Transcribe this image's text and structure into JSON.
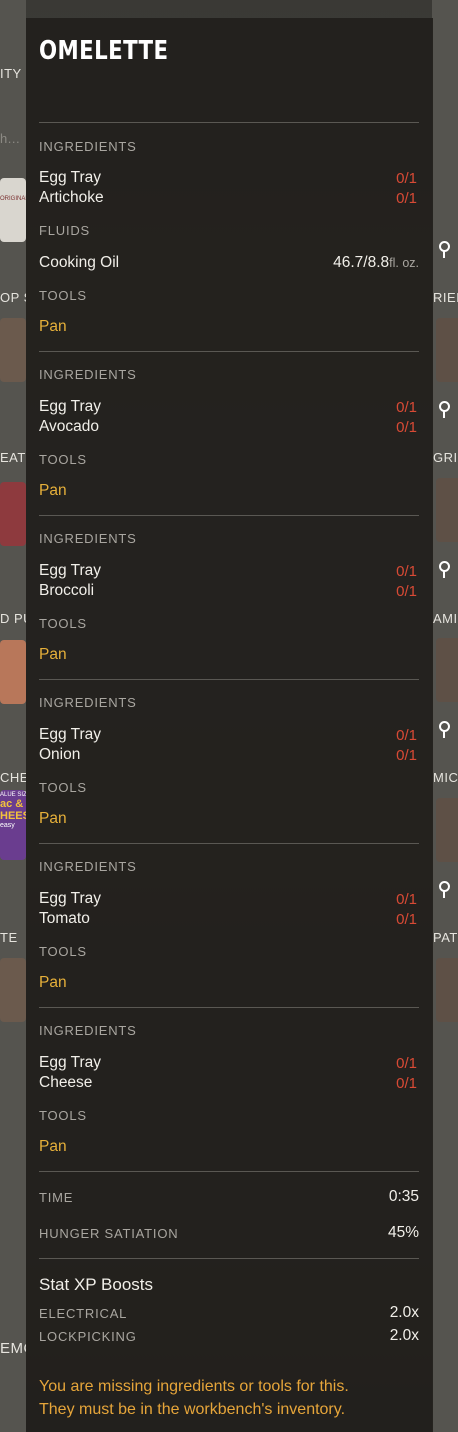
{
  "background": {
    "left_labels": [
      "ITY",
      "h...",
      "OP S",
      "EAT",
      "D PU",
      "CHE",
      "TE",
      "EMO"
    ],
    "right_labels": [
      "RIEI",
      "GRIL",
      "AMI",
      "MICH",
      "PATI"
    ],
    "thumb_text": [
      "ORIGINAL",
      "ac &",
      "HEESI",
      "ALUE SIZE",
      "easy"
    ]
  },
  "recipe": {
    "title": "OMELETTE",
    "headings": {
      "ingredients": "INGREDIENTS",
      "fluids": "FLUIDS",
      "tools": "TOOLS"
    },
    "variants": [
      {
        "ingredients": [
          {
            "name": "Egg Tray",
            "qty": "0/1"
          },
          {
            "name": "Artichoke",
            "qty": "0/1"
          }
        ],
        "fluid": {
          "name": "Cooking Oil",
          "amount": "46.7/8.8",
          "unit": "fl. oz."
        },
        "tool": "Pan"
      },
      {
        "ingredients": [
          {
            "name": "Egg Tray",
            "qty": "0/1"
          },
          {
            "name": "Avocado",
            "qty": "0/1"
          }
        ],
        "tool": "Pan"
      },
      {
        "ingredients": [
          {
            "name": "Egg Tray",
            "qty": "0/1"
          },
          {
            "name": "Broccoli",
            "qty": "0/1"
          }
        ],
        "tool": "Pan"
      },
      {
        "ingredients": [
          {
            "name": "Egg Tray",
            "qty": "0/1"
          },
          {
            "name": "Onion",
            "qty": "0/1"
          }
        ],
        "tool": "Pan"
      },
      {
        "ingredients": [
          {
            "name": "Egg Tray",
            "qty": "0/1"
          },
          {
            "name": "Tomato",
            "qty": "0/1"
          }
        ],
        "tool": "Pan"
      },
      {
        "ingredients": [
          {
            "name": "Egg Tray",
            "qty": "0/1"
          },
          {
            "name": "Cheese",
            "qty": "0/1"
          }
        ],
        "tool": "Pan"
      }
    ],
    "stats": {
      "time_label": "TIME",
      "time_value": "0:35",
      "hunger_label": "HUNGER SATIATION",
      "hunger_value": "45%"
    },
    "xp": {
      "title": "Stat XP Boosts",
      "boosts": [
        {
          "label": "ELECTRICAL",
          "value": "2.0x"
        },
        {
          "label": "LOCKPICKING",
          "value": "2.0x"
        }
      ]
    },
    "warning": [
      "You are missing ingredients or tools for this.",
      "They must be in the workbench's inventory."
    ]
  },
  "colors": {
    "missing": "#d84a35",
    "tool": "#e6b03a",
    "warning": "#e6a53a"
  }
}
